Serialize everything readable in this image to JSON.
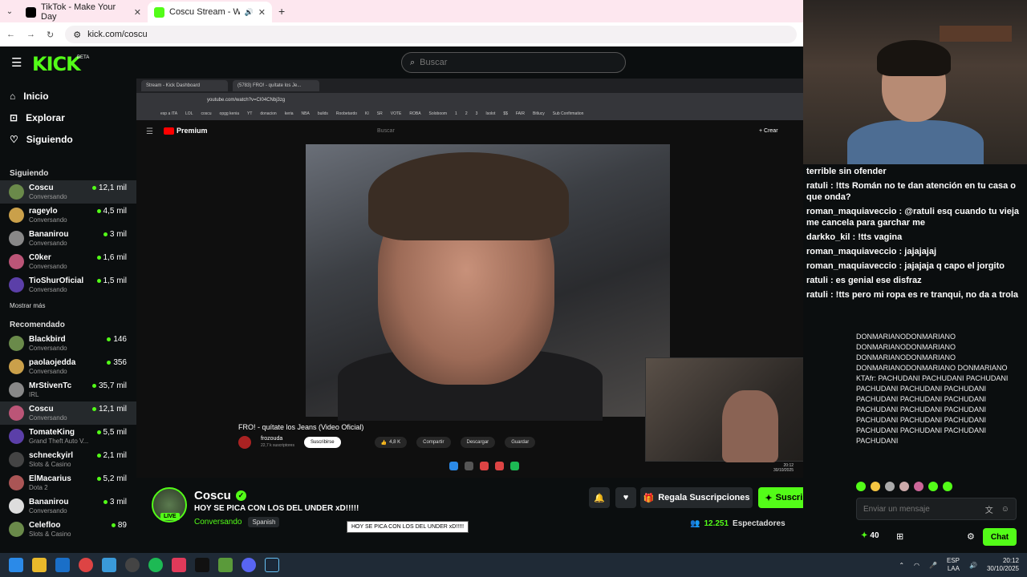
{
  "browser": {
    "tabs": [
      {
        "label": "TikTok - Make Your Day"
      },
      {
        "label": "Coscu Stream - Watch Live"
      }
    ],
    "url": "kick.com/coscu"
  },
  "header": {
    "search_placeholder": "Buscar"
  },
  "sidebar": {
    "nav": [
      {
        "label": "Inicio"
      },
      {
        "label": "Explorar"
      },
      {
        "label": "Siguiendo"
      }
    ],
    "following_title": "Siguiendo",
    "following": [
      {
        "name": "Coscu",
        "category": "Conversando",
        "viewers": "12,1 mil"
      },
      {
        "name": "rageylo",
        "category": "Conversando",
        "viewers": "4,5 mil"
      },
      {
        "name": "Bananirou",
        "category": "Conversando",
        "viewers": "3 mil"
      },
      {
        "name": "C0ker",
        "category": "Conversando",
        "viewers": "1,6 mil"
      },
      {
        "name": "TioShurOficial",
        "category": "Conversando",
        "viewers": "1,5 mil"
      }
    ],
    "show_more": "Mostrar más",
    "recommended_title": "Recomendado",
    "recommended": [
      {
        "name": "Blackbird",
        "category": "Conversando",
        "viewers": "146"
      },
      {
        "name": "paolaojedda",
        "category": "Conversando",
        "viewers": "356"
      },
      {
        "name": "MrStivenTc",
        "category": "IRL",
        "viewers": "35,7 mil"
      },
      {
        "name": "Coscu",
        "category": "Conversando",
        "viewers": "12,1 mil"
      },
      {
        "name": "TomateKing",
        "category": "Grand Theft Auto V...",
        "viewers": "5,5 mil"
      },
      {
        "name": "schneckyirl",
        "category": "Slots & Casino",
        "viewers": "2,1 mil"
      },
      {
        "name": "ElMacarius",
        "category": "Dota 2",
        "viewers": "5,2 mil"
      },
      {
        "name": "Bananirou",
        "category": "Conversando",
        "viewers": "3 mil"
      },
      {
        "name": "Celefloo",
        "category": "Slots & Casino",
        "viewers": "89"
      }
    ]
  },
  "video": {
    "inner_tab_1": "Stream - Kick Dashboard",
    "inner_tab_2": "(5783) FRO! - quítate los Je...",
    "inner_url": "youtube.com/watch?v=CI04CNbj3zg",
    "bookmarks": [
      "esp a ITA",
      "LOL",
      "coscu",
      "opgg kenia",
      "YT",
      "donacion",
      "keria",
      "NBA",
      "builds",
      "Roobetardo",
      "KI",
      "SR",
      "VOTE",
      "ROBA",
      "Soloboom",
      "1",
      "2",
      "3",
      "Isolot",
      "$$",
      "FAIR",
      "Bitlucy",
      "Sub Confirmation"
    ],
    "yt_brand": "Premium",
    "yt_search": "Buscar",
    "yt_create": "+ Crear",
    "title": "FRO! - quítate los Jeans (Video Oficial)",
    "channel": "frozouda",
    "subs": "22,7 k suscriptores",
    "subscribe": "Suscribirse",
    "likes": "4,8 K",
    "share": "Compartir",
    "download": "Descargar",
    "save": "Guardar",
    "screen_time": "20:12",
    "screen_date": "30/10/2025"
  },
  "stream": {
    "name": "Coscu",
    "live": "LIVE",
    "title": "HOY SE PICA CON LOS DEL UNDER xD!!!!!",
    "category": "Conversando",
    "language": "Spanish",
    "tooltip": "HOY SE PICA CON LOS DEL UNDER xD!!!!!",
    "gift_label": "Regala Suscripciones",
    "subscribe_label": "Suscribirse",
    "viewers": "12.251",
    "viewers_label": "Espectadores"
  },
  "chat": {
    "overlay_messages": [
      {
        "text": "terrible sin ofender"
      },
      {
        "text": "ratuli : !tts Román no te dan atención en tu casa o que onda?"
      },
      {
        "text": "roman_maquiaveccio : @ratuli esq cuando tu vieja me cancela para garchar me"
      },
      {
        "text": "darkko_kil : !tts vagina"
      },
      {
        "text": "roman_maquiaveccio : jajajajaj"
      },
      {
        "text": "roman_maquiaveccio : jajajaja q capo el jorgito"
      },
      {
        "text": "ratuli : es genial ese disfraz"
      },
      {
        "text": "ratuli : !tts pero mi ropa es re tranqui, no da a trola"
      }
    ],
    "spam_lines": [
      {
        "text": "DONMARIANODONMARIANO"
      },
      {
        "text": "DONMARIANODONMARIANO"
      },
      {
        "text": "DONMARIANODONMARIANO"
      },
      {
        "text": "DONMARIANODONMARIANO DONMARIANO"
      },
      {
        "text": "KTAfr: PACHUDANI PACHUDANI PACHUDANI"
      },
      {
        "text": "PACHUDANI PACHUDANI PACHUDANI"
      },
      {
        "text": "PACHUDANI PACHUDANI PACHUDANI"
      },
      {
        "text": "PACHUDANI PACHUDANI PACHUDANI"
      },
      {
        "text": "PACHUDANI PACHUDANI PACHUDANI"
      },
      {
        "text": "PACHUDANI PACHUDANI PACHUDANI"
      },
      {
        "text": "PACHUDANI"
      }
    ],
    "input_placeholder": "Enviar un mensaje",
    "points": "40",
    "send_label": "Chat"
  },
  "taskbar": {
    "lang_top": "ESP",
    "lang_bottom": "LAA",
    "time": "20:12",
    "date": "30/10/2025"
  },
  "colors": {
    "accent": "#53fc18",
    "background": "#0b0e0f"
  }
}
